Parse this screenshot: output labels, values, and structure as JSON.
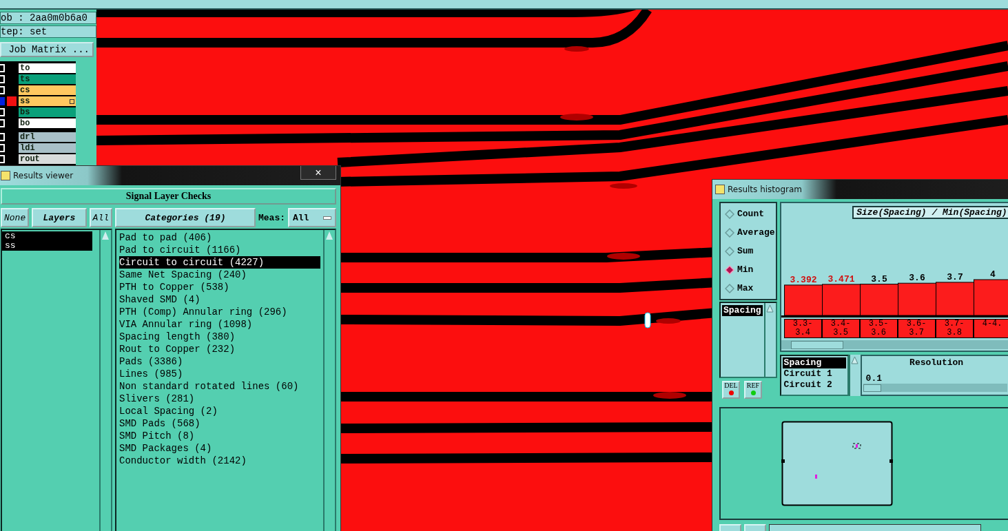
{
  "job": {
    "job_label": "ob : 2aa0m0b6a0",
    "step_label": "tep: set",
    "matrix_button": "Job Matrix ..."
  },
  "layers": [
    {
      "name": "to",
      "color": "#ffffff",
      "selected": false
    },
    {
      "name": "ts",
      "color": "#0aa07a",
      "selected": false
    },
    {
      "name": "cs",
      "color": "#ffc860",
      "selected": false
    },
    {
      "name": "ss",
      "color": "#ffc860",
      "selected": true
    },
    {
      "name": "bs",
      "color": "#0aa07a",
      "selected": false
    },
    {
      "name": "bo",
      "color": "#ffffff",
      "selected": false
    },
    {
      "name": "drl",
      "color": "#a8c0c8",
      "selected": false
    },
    {
      "name": "ldi",
      "color": "#a8c0c8",
      "selected": false
    },
    {
      "name": "rout",
      "color": "#d8dcdc",
      "selected": false
    }
  ],
  "results_viewer": {
    "title": "Results viewer",
    "close": "×",
    "header": "Signal Layer Checks",
    "none_button": "None",
    "layers_button": "Layers",
    "all_button": "All",
    "layer_list": [
      {
        "label": "cs",
        "selected": true
      },
      {
        "label": "ss",
        "selected": true
      }
    ],
    "categories_button": "Categories (19)",
    "meas_label": "Meas:",
    "meas_value": "All",
    "categories": [
      {
        "label": "Pad to pad (406)",
        "selected": false
      },
      {
        "label": "Pad to circuit (1166)",
        "selected": false
      },
      {
        "label": "Circuit to circuit (4227)",
        "selected": true
      },
      {
        "label": "Same Net Spacing (240)",
        "selected": false
      },
      {
        "label": "PTH to Copper (538)",
        "selected": false
      },
      {
        "label": "Shaved SMD (4)",
        "selected": false
      },
      {
        "label": "PTH (Comp) Annular ring (296)",
        "selected": false
      },
      {
        "label": "VIA Annular ring (1098)",
        "selected": false
      },
      {
        "label": "Spacing length (380)",
        "selected": false
      },
      {
        "label": "Rout to Copper (232)",
        "selected": false
      },
      {
        "label": "Pads (3386)",
        "selected": false
      },
      {
        "label": "Lines (985)",
        "selected": false
      },
      {
        "label": "Non standard rotated lines (60)",
        "selected": false
      },
      {
        "label": "Slivers (281)",
        "selected": false
      },
      {
        "label": "Local Spacing (2)",
        "selected": false
      },
      {
        "label": "SMD Pads (568)",
        "selected": false
      },
      {
        "label": "SMD Pitch (8)",
        "selected": false
      },
      {
        "label": "SMD Packages (4)",
        "selected": false
      },
      {
        "label": "Conductor width (2142)",
        "selected": false
      }
    ]
  },
  "results_histogram": {
    "title": "Results histogram",
    "modes": [
      {
        "label": "Count",
        "selected": false
      },
      {
        "label": "Average",
        "selected": false
      },
      {
        "label": "Sum",
        "selected": false
      },
      {
        "label": "Min",
        "selected": true
      },
      {
        "label": "Max",
        "selected": false
      }
    ],
    "measure_list": [
      {
        "label": "Spacing",
        "selected": true
      }
    ],
    "del_button": "DEL",
    "ref_button": "REF",
    "chart_data": {
      "type": "bar",
      "title": "Size(Spacing) / Min(Spacing)",
      "categories": [
        "3.3-3.4",
        "3.4-3.5",
        "3.5-3.6",
        "3.6-3.7",
        "3.7-3.8",
        "4-4."
      ],
      "series": [
        {
          "color": "#fc1c1c",
          "values": [
            3.392,
            3.471,
            3.5,
            3.6,
            3.7,
            4
          ]
        }
      ],
      "data_labels": true
    },
    "bins": [
      {
        "flagged": true
      },
      {
        "flagged": true
      },
      {
        "flagged": false
      },
      {
        "flagged": false
      },
      {
        "flagged": false
      },
      {
        "flagged": false
      }
    ],
    "field_list": [
      {
        "label": "Spacing",
        "selected": true
      },
      {
        "label": "Circuit 1",
        "selected": false
      },
      {
        "label": "Circuit 2",
        "selected": false
      }
    ],
    "resolution_label": "Resolution",
    "resolution_value": "0.1",
    "resolution_slider": {
      "level": 0.0
    }
  }
}
